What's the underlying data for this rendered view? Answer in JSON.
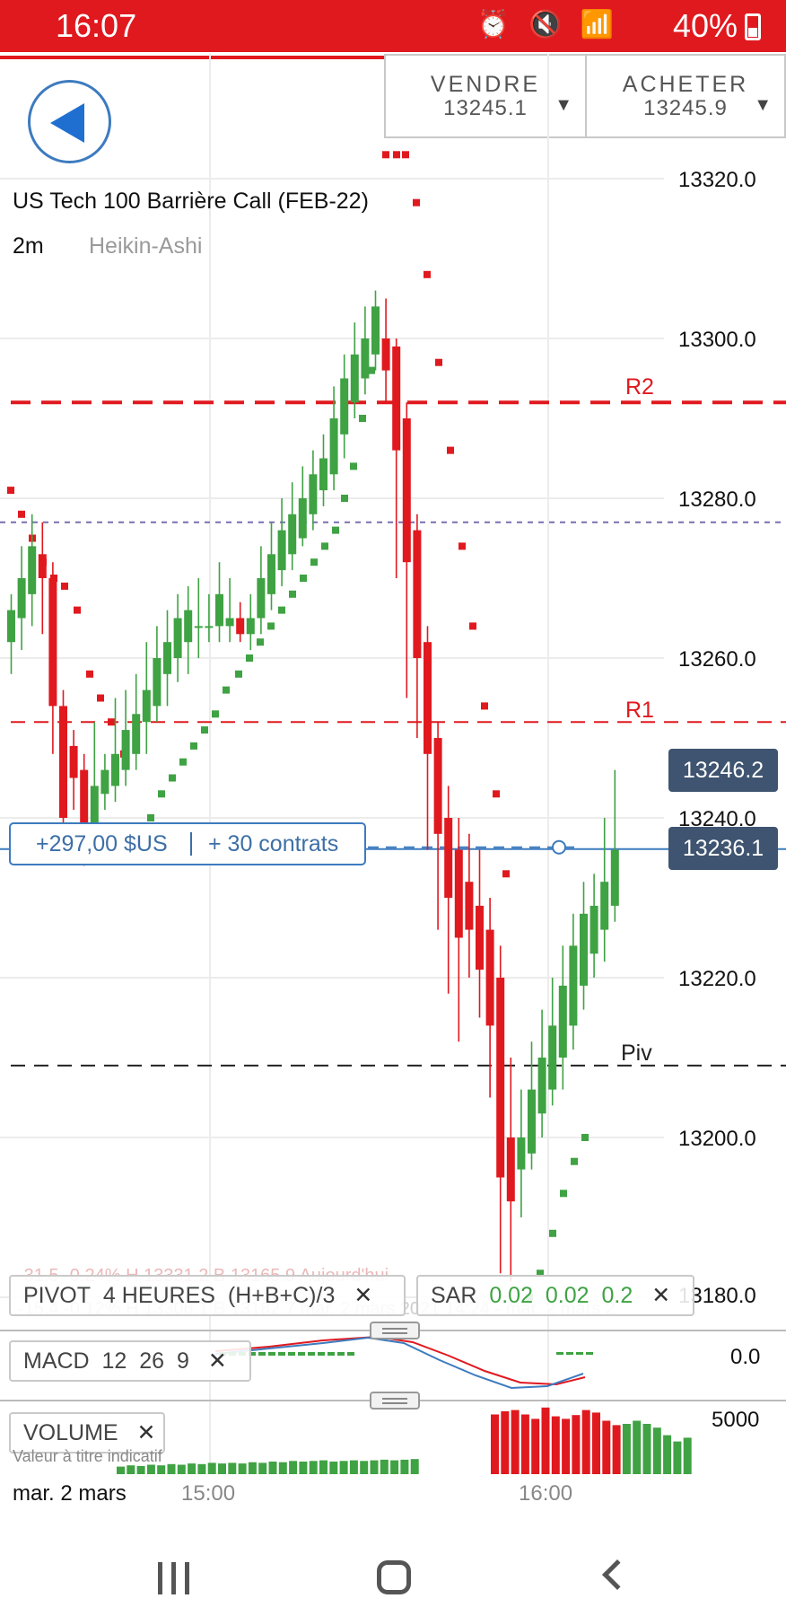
{
  "status_bar": {
    "time": "16:07",
    "icons": "⏰ 🔇 📶",
    "battery": "40%"
  },
  "header": {
    "back_icon": "back-triangle-icon",
    "sell": {
      "label": "VENDRE",
      "value": "13245.1"
    },
    "buy": {
      "label": "ACHETER",
      "value": "13245.9"
    }
  },
  "chart": {
    "title": "US Tech 100 Barrière Call (FEB-22)",
    "interval": "2m",
    "kind": "Heikin-Ashi",
    "y_ticks": [
      "13320.0",
      "13300.0",
      "13280.0",
      "13260.0",
      "13240.0",
      "13220.0",
      "13200.0",
      "13180.0"
    ],
    "levels": {
      "r2": "R2",
      "r1": "R1",
      "piv": "Piv"
    },
    "current_price_tag": "13246.2",
    "position_price_tag": "13236.1",
    "colors": {
      "up": "#3fa243",
      "down": "#e0191f",
      "position": "#3d7bbf",
      "tag": "#3e5470"
    }
  },
  "chart_data": {
    "type": "candlestick",
    "y_ticks": [
      13320,
      13300,
      13280,
      13260,
      13240,
      13220,
      13200,
      13180
    ],
    "ylim": [
      13180,
      13320
    ],
    "levels": {
      "R2": 13292,
      "R1": 13252,
      "Piv": 13209,
      "dotted": 13277,
      "position": 13236.1
    }
  },
  "position": {
    "pnl": "+297,00 $US",
    "quantity": "+ 30 contrats"
  },
  "indicators": {
    "pivot": {
      "name": "PIVOT",
      "period": "4 HEURES",
      "formula": "(H+B+C)/3"
    },
    "sar": {
      "name": "SAR",
      "p1": "0.02",
      "p2": "0.02",
      "p3": "0.2"
    },
    "macd": {
      "name": "MACD",
      "p1": "12",
      "p2": "26",
      "p3": "9",
      "zero_label": "0.0"
    },
    "volume": {
      "name": "VOLUME",
      "max_label": "5000"
    }
  },
  "ghost_overlay": {
    "line1": "-31.5    -0.24%    H 13331.2    B 13165.9    Aujourd'hui",
    "line2": "-15.4    -0.12%    H 13306.1    B 13182.7    mar. 2 mars 2021 14:24 - mar. 2 mars 2"
  },
  "x_axis": {
    "date": "mar. 2 mars",
    "t1": "15:00",
    "t2": "16:00"
  },
  "note": "Valeur à titre indicatif"
}
